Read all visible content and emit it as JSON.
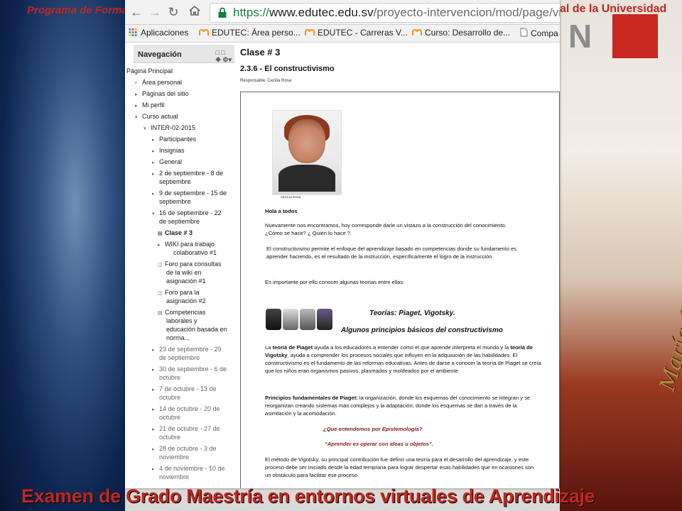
{
  "slide": {
    "header_left": "Programa de Formac",
    "header_right": "al de     la Universidad",
    "footer": "Examen de Grado Maestría en entornos virtuales de Aprendizaje",
    "signature": "María Cecilia Rosa"
  },
  "browser": {
    "url_scheme": "https://",
    "url_host": "www.edutec.edu.sv",
    "url_path": "/proyecto-intervencion/mod/page/view",
    "bookmarks": [
      {
        "label": "Aplicaciones",
        "icon": "apps-grid-icon"
      },
      {
        "label": "EDUTEC: Área perso...",
        "icon": "moodle-icon"
      },
      {
        "label": "EDUTEC - Carreras V...",
        "icon": "moodle-icon"
      },
      {
        "label": "Curso: Desarrollo de...",
        "icon": "moodle-icon"
      },
      {
        "label": "Compa",
        "icon": "page-icon"
      }
    ]
  },
  "navigation": {
    "title": "Navegación",
    "items": [
      {
        "label": "Página Principal"
      },
      {
        "label": "Área personal"
      },
      {
        "label": "Páginas del sitio"
      },
      {
        "label": "Mi perfil"
      },
      {
        "label": "Curso actual"
      },
      {
        "label": "INTER-02-2015"
      },
      {
        "label": "Participantes"
      },
      {
        "label": "Insignias"
      },
      {
        "label": "General"
      },
      {
        "label": "2 de septiembre - 8 de"
      },
      {
        "label": "septiembre"
      },
      {
        "label": "9 de septiembre - 15 de"
      },
      {
        "label": "septiembre"
      },
      {
        "label": "16 de septiembre - 22"
      },
      {
        "label": "de septiembre"
      },
      {
        "label": "Clase # 3"
      },
      {
        "label": "WIKI para trabajo"
      },
      {
        "label": "colaborativo #1"
      },
      {
        "label": "Foro para consultas"
      },
      {
        "label": "de la wiki en"
      },
      {
        "label": "asignación #1"
      },
      {
        "label": "Foro para la"
      },
      {
        "label": "asignación #2"
      },
      {
        "label": "Competencias"
      },
      {
        "label": "laborales y"
      },
      {
        "label": "educación basada en"
      },
      {
        "label": "norma..."
      },
      {
        "label": "23 de septiembre - 29"
      },
      {
        "label": "de septiembre"
      },
      {
        "label": "30 de septiembre - 6 de"
      },
      {
        "label": "octubre"
      },
      {
        "label": "7 de octubre - 13 de"
      },
      {
        "label": "octubre"
      },
      {
        "label": "14 de octubre - 20 de"
      },
      {
        "label": "octubre"
      },
      {
        "label": "21 de octubre - 27 de"
      },
      {
        "label": "octubre"
      },
      {
        "label": "28 de octubre - 3 de"
      },
      {
        "label": "noviembre"
      },
      {
        "label": "4 de noviembre - 10 de"
      },
      {
        "label": "noviembre"
      }
    ]
  },
  "content": {
    "class_title": "Clase # 3",
    "section_title": "2.3.6 - El constructivismo",
    "responsable": "Responsable: Cecilia Rosa",
    "photo_caption": "CECILIA ROSA",
    "greeting": "Hola a todos",
    "p1": "Nuevamente  nos encontramos, hoy corresponde  darle un vistazo a la construcción del conocimiento. ¿Cómo se hace? ¿ Quién lo hace ?.",
    "p2": "El constructivismo permite  el  enfoque  del aprendizaje  basado  en competencias donde  su fundamento es  aprender haciendo,  es el resultado de la instrucción, específicamente   el logro de la instrucción.",
    "p3": "Es importante por ello conocer  algunas teorías entre ellas:",
    "theories_title": "Teorías: Piaget, Vigotsky.",
    "principles_title": "Algunos principios básicos del constructivismo",
    "p4_a": "La ",
    "p4_b": "teoría de Piaget",
    "p4_c": " ayuda a los educadores a entender como  el que aprende  interpreta el mundo y la ",
    "p4_d": "teoría de Vigotsky",
    "p4_e": ", ayuda a comprender los procesos sociales que influyen en la adquisición de las habilidades.  El constructivismo es el fundamento de las reformas educativas. Antes de darse a conocer la teoría  de Piaget se creía que los niños eran organismos pasivos, plasmados y moldeados por el ambiente.",
    "p5_a": "Principios fundamentales de Piaget:",
    "p5_b": " la organización, donde los esquemas del conocimiento se integran y se reorganizan creando sistemas más complejos y la adaptación;  donde los esquemas  se dan a través de la asimilación y la acomodación.",
    "q1": "¿Que entendemos por  Epistemología?",
    "q2": "“Aprender es operar con ideas u objetos”.",
    "p6": "El método de Vigotsky, su principal contribución fue definir  una teoría para el desarrollo del aprendizaje, y este proceso  debe ser iniciado desde  la edad temprana  para lograr  despertar esas habilidades que en ocasiones son un obstáculo para facilitar ese proceso."
  },
  "colors": {
    "slide_red": "#c0271d",
    "url_green": "#188038",
    "quote_red": "#8b1a1a"
  }
}
